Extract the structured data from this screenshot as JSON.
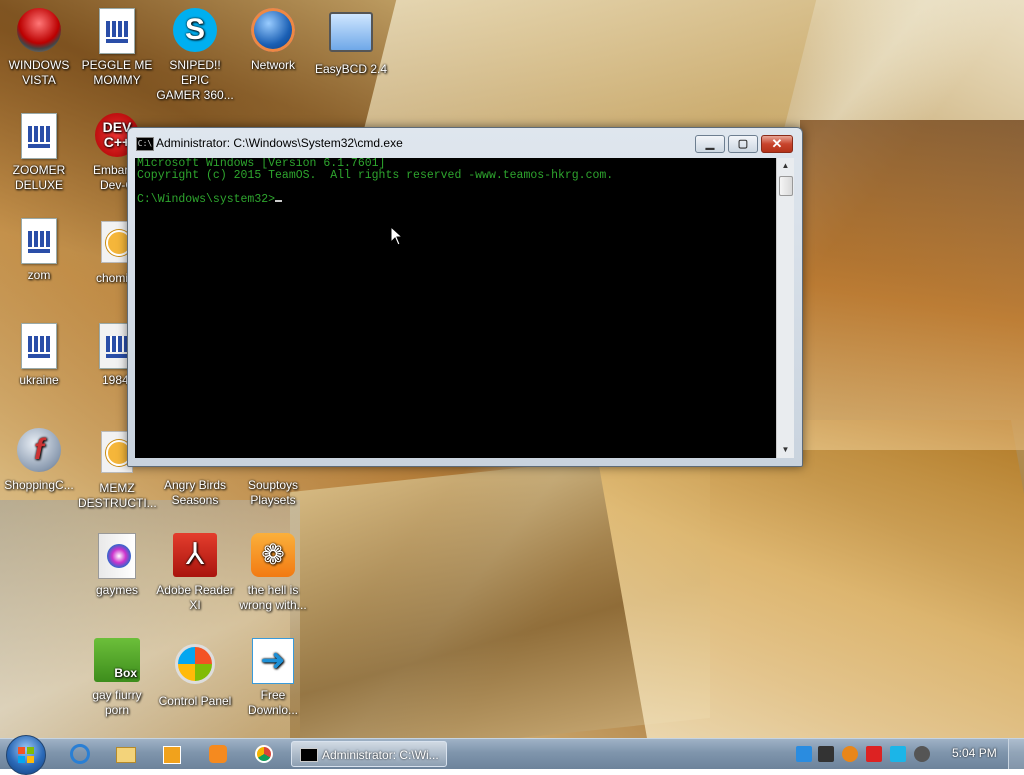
{
  "desktop_icons": [
    {
      "label": "WINDOWS\nVISTA",
      "icon": "vista-icon"
    },
    {
      "label": "PEGGLE ME\nMOMMY",
      "icon": "document-icon"
    },
    {
      "label": "SNIPED!! EPIC\nGAMER 360...",
      "icon": "skype-icon"
    },
    {
      "label": "Network",
      "icon": "network-icon"
    },
    {
      "label": "EasyBCD 2.4",
      "icon": "easybcd-icon"
    },
    {
      "label": "ZOOMER\nDELUXE",
      "icon": "document-icon"
    },
    {
      "label": "Embarca\nDev-C",
      "icon": "devcpp-icon"
    },
    {
      "label": "zom",
      "icon": "document-icon"
    },
    {
      "label": "chomikr",
      "icon": "clock-icon"
    },
    {
      "label": "ukraine",
      "icon": "document-icon"
    },
    {
      "label": "1984.",
      "icon": "text-file-icon"
    },
    {
      "label": "ShoppingC...",
      "icon": "flash-icon"
    },
    {
      "label": "MEMZ\nDESTRUCTI...",
      "icon": "clock-icon"
    },
    {
      "label": "Angry Birds\nSeasons",
      "icon": "angry-birds-icon"
    },
    {
      "label": "Souptoys\nPlaysets",
      "icon": "souptoys-icon"
    },
    {
      "label": "gaymes",
      "icon": "folder-icon"
    },
    {
      "label": "Adobe Reader\nXI",
      "icon": "adobe-reader-icon"
    },
    {
      "label": "the hell is\nwrong with...",
      "icon": "uc-browser-icon"
    },
    {
      "label": "gay fiurry\nporn",
      "icon": "box-game-icon"
    },
    {
      "label": "Control Panel",
      "icon": "control-panel-icon"
    },
    {
      "label": "Free\nDownlo...",
      "icon": "free-download-icon"
    }
  ],
  "cmd_window": {
    "title": "Administrator: C:\\Windows\\System32\\cmd.exe",
    "icon_text": "C:\\",
    "lines": [
      "Microsoft Windows [Version 6.1.7601]",
      "Copyright (c) 2015 TeamOS.  All rights reserved -www.teamos-hkrg.com.",
      "",
      "C:\\Windows\\system32>"
    ],
    "buttons": {
      "minimize": "▁",
      "maximize": "▢",
      "close": "✕"
    }
  },
  "taskbar": {
    "active_task_label": "Administrator: C:\\Wi...",
    "clock": "5:04 PM"
  },
  "colors": {
    "console_text": "#2ea52e",
    "console_bg": "#000000",
    "taskbar": "#7f95ac"
  }
}
